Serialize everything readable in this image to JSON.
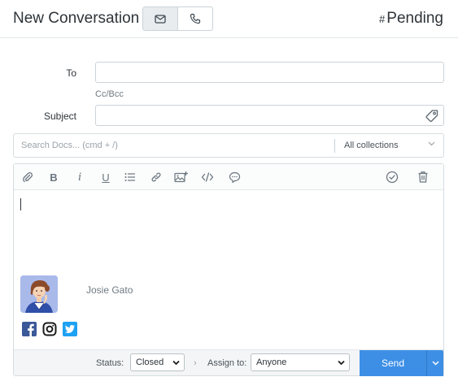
{
  "header": {
    "title": "New Conversation",
    "status_hash": "#",
    "status_text": "Pending",
    "type_toggle": {
      "active": "email",
      "options": [
        "mail-icon",
        "phone-icon"
      ]
    }
  },
  "form": {
    "to_label": "To",
    "to_value": "",
    "cc_bcc": "Cc/Bcc",
    "subject_label": "Subject",
    "subject_value": ""
  },
  "docs_search": {
    "placeholder": "Search Docs... (cmd + /)",
    "collections_label": "All collections"
  },
  "toolbar": {
    "items": [
      "paperclip-icon",
      "bold-icon",
      "italic-icon",
      "underline-icon",
      "list-icon",
      "link-icon",
      "image-icon",
      "code-icon",
      "chat-icon",
      "check-circle-icon",
      "trash-icon"
    ],
    "bold_glyph": "B",
    "italic_glyph": "i",
    "underline_glyph": "U"
  },
  "signature": {
    "name": "Josie Gato",
    "socials": [
      "facebook-icon",
      "instagram-icon",
      "twitter-icon"
    ]
  },
  "footer": {
    "status_label": "Status:",
    "status_value": "Closed",
    "assign_label": "Assign to:",
    "assign_value": "Anyone",
    "send_label": "Send"
  },
  "colors": {
    "primary": "#3d8fe6",
    "border": "#ccd3d8",
    "facebook": "#3b5998",
    "twitter": "#1da1f2"
  }
}
